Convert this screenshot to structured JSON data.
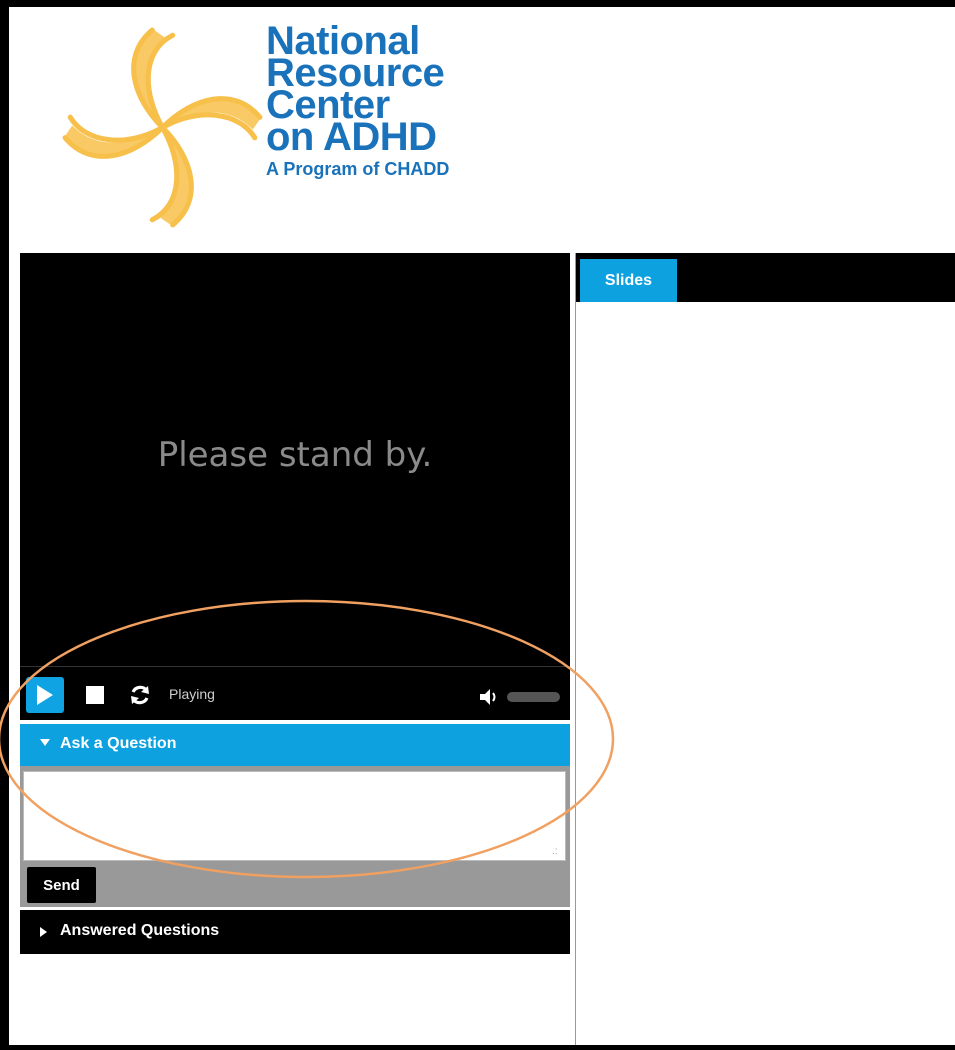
{
  "header": {
    "brand_line1": "National",
    "brand_line2": "Resource",
    "brand_line3": "Center",
    "brand_line4": "on ADHD",
    "brand_sub": "A Program of CHADD",
    "brand_color": "#1a73ba",
    "logo_color": "#f7c04a"
  },
  "player": {
    "standby_text": "Please stand by.",
    "status": "Playing",
    "volume_level": 0.0,
    "accent_color": "#0ea1e0"
  },
  "ask": {
    "title": "Ask a Question",
    "input_value": "",
    "send_label": "Send"
  },
  "answered": {
    "title": "Answered Questions"
  },
  "slides_panel": {
    "tab_label": "Slides"
  },
  "annotation": {
    "ellipse_color": "#f0a060"
  }
}
